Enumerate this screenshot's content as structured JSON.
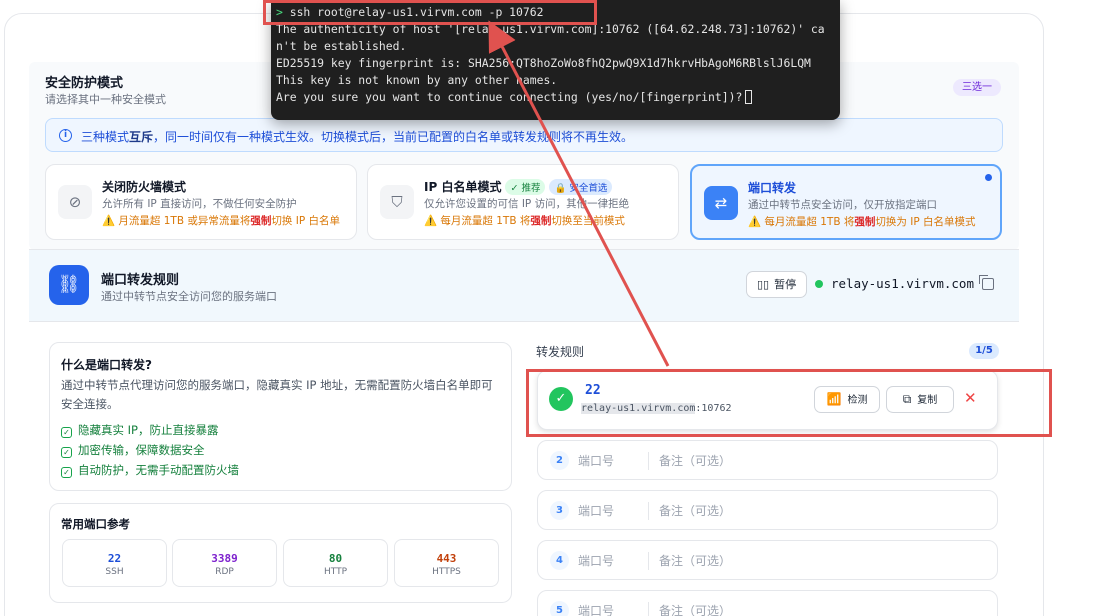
{
  "security": {
    "title": "安全防护模式",
    "subtitle": "请选择其中一种安全模式",
    "choose_badge": "三选一",
    "info_prefix": "三种模式",
    "info_bold": "互斥",
    "info_suffix": "，同一时间仅有一种模式生效。切换模式后，当前已配置的白名单或转发规则将不再生效。",
    "modes": [
      {
        "title": "关闭防火墙模式",
        "desc": "允许所有 IP 直接访问，不做任何安全防护",
        "warn_prefix": "⚠️ 月流量超 1TB 或异常流量将",
        "warn_bold": "强制",
        "warn_suffix": "切换 IP 白名单",
        "icon": "shield-off-icon"
      },
      {
        "title": "IP 白名单模式",
        "tag_recommend": "推荐",
        "tag_safe": "安全首选",
        "desc": "仅允许您设置的可信 IP 访问，其他一律拒绝",
        "warn_prefix": "⚠️ 每月流量超 1TB 将",
        "warn_bold": "强制",
        "warn_suffix": "切换至当前模式",
        "icon": "shield-check-icon"
      },
      {
        "title": "端口转发",
        "desc": "通过中转节点安全访问，仅开放指定端口",
        "warn_prefix": "⚠️ 每月流量超 1TB 将",
        "warn_bold": "强制",
        "warn_suffix": "切换为 IP 白名单模式",
        "icon": "swap-arrows-icon",
        "selected": true
      }
    ]
  },
  "forwarding": {
    "title": "端口转发规则",
    "subtitle": "通过中转节点安全访问您的服务端口",
    "pause_label": "暂停",
    "host": "relay-us1.virvm.com",
    "status_color": "#22c55e"
  },
  "explain": {
    "title": "什么是端口转发?",
    "desc": "通过中转节点代理访问您的服务端口，隐藏真实 IP 地址，无需配置防火墙白名单即可安全连接。",
    "features": [
      "隐藏真实 IP，防止直接暴露",
      "加密传输，保障数据安全",
      "自动防护，无需手动配置防火墙"
    ]
  },
  "common_ports": {
    "title": "常用端口参考",
    "items": [
      {
        "port": "22",
        "name": "SSH",
        "color": "#1d4ed8"
      },
      {
        "port": "3389",
        "name": "RDP",
        "color": "#7e22ce"
      },
      {
        "port": "80",
        "name": "HTTP",
        "color": "#15803d"
      },
      {
        "port": "443",
        "name": "HTTPS",
        "color": "#c2410c"
      }
    ]
  },
  "rules": {
    "title": "转发规则",
    "count": "1/5",
    "active": {
      "port": "22",
      "host": "relay-us1.virvm.com",
      "remote_port": ":10762",
      "check_label": "检测",
      "copy_label": "复制"
    },
    "empty": [
      {
        "num": "2",
        "port_placeholder": "端口号",
        "note_placeholder": "备注（可选）"
      },
      {
        "num": "3",
        "port_placeholder": "端口号",
        "note_placeholder": "备注（可选）"
      },
      {
        "num": "4",
        "port_placeholder": "端口号",
        "note_placeholder": "备注（可选）"
      },
      {
        "num": "5",
        "port_placeholder": "端口号",
        "note_placeholder": "备注（可选）"
      }
    ]
  },
  "terminal": {
    "prompt": ">",
    "command": " ssh root@relay-us1.virvm.com -p 10762",
    "lines": [
      "The authenticity of host '[relay-us1.virvm.com]:10762 ([64.62.248.73]:10762)' ca",
      "n't be established.",
      "ED25519 key fingerprint is: SHA256:QT8hoZoWo8fhQ2pwQ9X1d7hkrvHbAgoM6RBlslJ6LQM",
      "This key is not known by any other names.",
      "Are you sure you want to continue connecting (yes/no/[fingerprint])?"
    ]
  },
  "colors": {
    "accent": "#2563eb",
    "annotation_red": "#e0524f",
    "warning": "#d97706",
    "danger": "#dc2626"
  }
}
